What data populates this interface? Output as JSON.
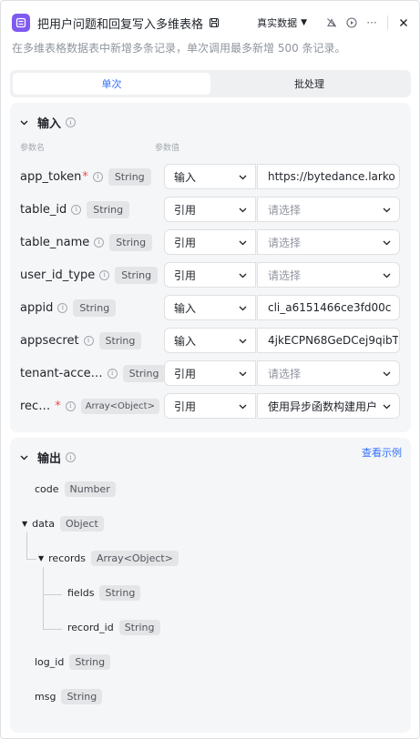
{
  "header": {
    "title": "把用户问题和回复写入多维表格",
    "mode_label": "真实数据",
    "description": "在多维表格数据表中新增多条记录，单次调用最多新增 500 条记录。"
  },
  "tabs": [
    {
      "label": "单次",
      "active": true
    },
    {
      "label": "批处理",
      "active": false
    }
  ],
  "input_section": {
    "title": "输入",
    "col_name": "参数名",
    "col_value": "参数值",
    "params": [
      {
        "name": "app_token",
        "required": true,
        "type": "String",
        "source": "输入",
        "value": "https://bytedance.larko",
        "placeholder": false
      },
      {
        "name": "table_id",
        "required": false,
        "type": "String",
        "source": "引用",
        "value": "请选择",
        "placeholder": true
      },
      {
        "name": "table_name",
        "required": false,
        "type": "String",
        "source": "引用",
        "value": "请选择",
        "placeholder": true
      },
      {
        "name": "user_id_type",
        "required": false,
        "type": "String",
        "source": "引用",
        "value": "请选择",
        "placeholder": true
      },
      {
        "name": "appid",
        "required": false,
        "type": "String",
        "source": "输入",
        "value": "cli_a6151466ce3fd00c",
        "placeholder": false
      },
      {
        "name": "appsecret",
        "required": false,
        "type": "String",
        "source": "输入",
        "value": "4jkECPN68GeDCej9qibT",
        "placeholder": false
      },
      {
        "name": "tenant-acce…",
        "required": false,
        "type": "String",
        "source": "引用",
        "value": "请选择",
        "placeholder": true
      },
      {
        "name": "rec…",
        "required": true,
        "type": "Array<Object>",
        "source": "引用",
        "value": "使用异步函数构建用户",
        "placeholder": false
      }
    ]
  },
  "output_section": {
    "title": "输出",
    "example_link": "查看示例",
    "fields": [
      {
        "name": "code",
        "type": "Number"
      },
      {
        "name": "data",
        "type": "Object"
      },
      {
        "name": "records",
        "type": "Array<Object>"
      },
      {
        "name": "fields",
        "type": "String"
      },
      {
        "name": "record_id",
        "type": "String"
      },
      {
        "name": "log_id",
        "type": "String"
      },
      {
        "name": "msg",
        "type": "String"
      }
    ]
  },
  "colors": {
    "accent": "#3370ff",
    "plugin_icon": "#7f5af0",
    "required": "#f54a45"
  },
  "icons": [
    "plugin-table-icon",
    "save-icon",
    "caret-down-icon",
    "no-image-icon",
    "play-icon",
    "more-icon",
    "close-icon",
    "info-icon",
    "chevron-down-icon",
    "triangle-down-icon"
  ]
}
